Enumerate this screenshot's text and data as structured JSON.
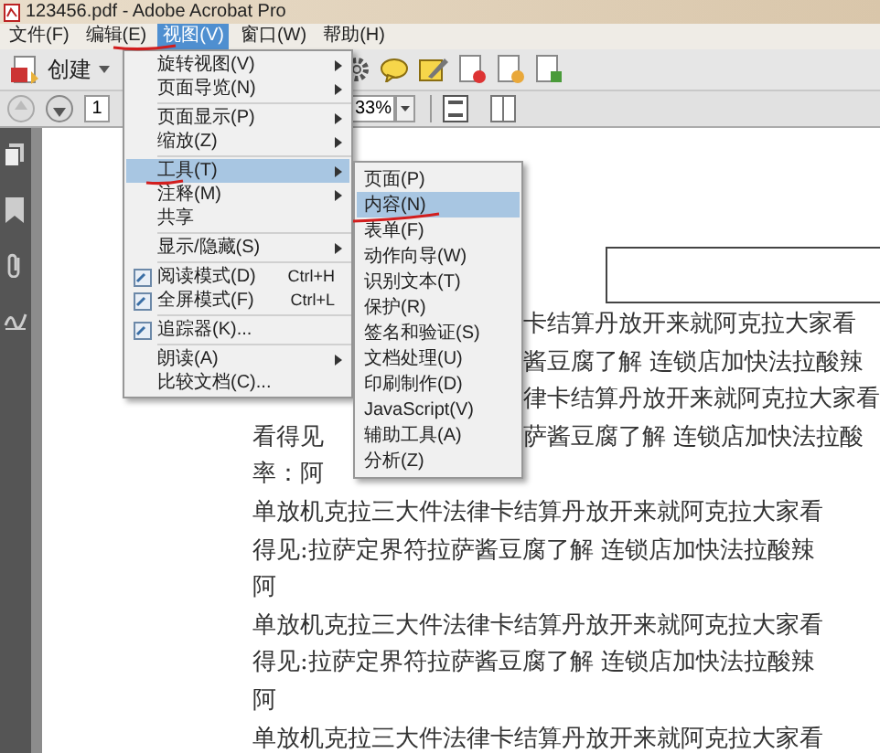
{
  "window": {
    "title": "123456.pdf - Adobe Acrobat Pro"
  },
  "menubar": [
    {
      "label": "文件(F)",
      "selected": false
    },
    {
      "label": "编辑(E)",
      "selected": false
    },
    {
      "label": "视图(V)",
      "selected": true
    },
    {
      "label": "窗口(W)",
      "selected": false
    },
    {
      "label": "帮助(H)",
      "selected": false
    }
  ],
  "toolbar": {
    "create_label": "创建"
  },
  "navigation": {
    "page": "1",
    "zoom": "33%"
  },
  "view_menu": {
    "items": [
      {
        "kind": "item",
        "label": "旋转视图(V)",
        "submenu": true,
        "selected": false
      },
      {
        "kind": "item",
        "label": "页面导览(N)",
        "submenu": true,
        "selected": false
      },
      {
        "kind": "separator"
      },
      {
        "kind": "item",
        "label": "页面显示(P)",
        "submenu": true,
        "selected": false
      },
      {
        "kind": "item",
        "label": "缩放(Z)",
        "submenu": true,
        "selected": false
      },
      {
        "kind": "separator"
      },
      {
        "kind": "item",
        "label": "工具(T)",
        "submenu": true,
        "selected": true
      },
      {
        "kind": "item",
        "label": "注释(M)",
        "submenu": true,
        "selected": false
      },
      {
        "kind": "item",
        "label": "共享",
        "submenu": false,
        "selected": false
      },
      {
        "kind": "separator"
      },
      {
        "kind": "item",
        "label": "显示/隐藏(S)",
        "submenu": true,
        "selected": false
      },
      {
        "kind": "separator"
      },
      {
        "kind": "icon_item",
        "label": "阅读模式(D)",
        "shortcut": "Ctrl+H",
        "submenu": false,
        "selected": false
      },
      {
        "kind": "icon_item",
        "label": "全屏模式(F)",
        "shortcut": "Ctrl+L",
        "submenu": false,
        "selected": false
      },
      {
        "kind": "separator"
      },
      {
        "kind": "icon_item",
        "label": "追踪器(K)...",
        "submenu": false,
        "selected": false
      },
      {
        "kind": "separator"
      },
      {
        "kind": "item",
        "label": "朗读(A)",
        "submenu": true,
        "selected": false
      },
      {
        "kind": "item",
        "label": "比较文档(C)...",
        "submenu": false,
        "selected": false
      }
    ]
  },
  "tools_submenu": {
    "items": [
      {
        "label": "页面(P)",
        "selected": false
      },
      {
        "label": "内容(N)",
        "selected": true
      },
      {
        "label": "表单(F)",
        "selected": false
      },
      {
        "label": "动作向导(W)",
        "selected": false
      },
      {
        "label": "识别文本(T)",
        "selected": false
      },
      {
        "label": "保护(R)",
        "selected": false
      },
      {
        "label": "签名和验证(S)",
        "selected": false
      },
      {
        "label": "文档处理(U)",
        "selected": false
      },
      {
        "label": "印刷制作(D)",
        "selected": false
      },
      {
        "label": "JavaScript(V)",
        "selected": false
      },
      {
        "label": "辅助工具(A)",
        "selected": false
      },
      {
        "label": "分析(Z)",
        "selected": false
      }
    ]
  },
  "document": {
    "lines": [
      {
        "kind": "after_menu",
        "parts": [
          "卡结算丹放开来就阿克拉大家看"
        ]
      },
      {
        "kind": "after_menu",
        "parts": [
          "酱豆腐了解 连锁店加快法拉酸辣"
        ]
      },
      {
        "kind": "after_menu",
        "parts": [
          "律卡结算丹放开来就阿克拉大家看"
        ]
      },
      {
        "kind": "split",
        "parts": [
          "看得见",
          "萨酱豆腐了解 连锁店加快法拉酸"
        ]
      },
      {
        "kind": "full",
        "parts": [
          "率：阿"
        ]
      },
      {
        "kind": "full",
        "parts": [
          "单放机克拉三大件法律卡结算丹放开来就阿克拉大家看"
        ]
      },
      {
        "kind": "full",
        "parts": [
          "得见:拉萨定界符拉萨酱豆腐了解 连锁店加快法拉酸辣"
        ]
      },
      {
        "kind": "full",
        "parts": [
          "阿"
        ]
      },
      {
        "kind": "full",
        "parts": [
          "单放机克拉三大件法律卡结算丹放开来就阿克拉大家看"
        ]
      },
      {
        "kind": "full",
        "parts": [
          "得见:拉萨定界符拉萨酱豆腐了解 连锁店加快法拉酸辣"
        ]
      },
      {
        "kind": "full",
        "parts": [
          "阿"
        ]
      },
      {
        "kind": "full",
        "parts": [
          "单放机克拉三大件法律卡结算丹放开来就阿克拉大家看"
        ]
      }
    ]
  }
}
